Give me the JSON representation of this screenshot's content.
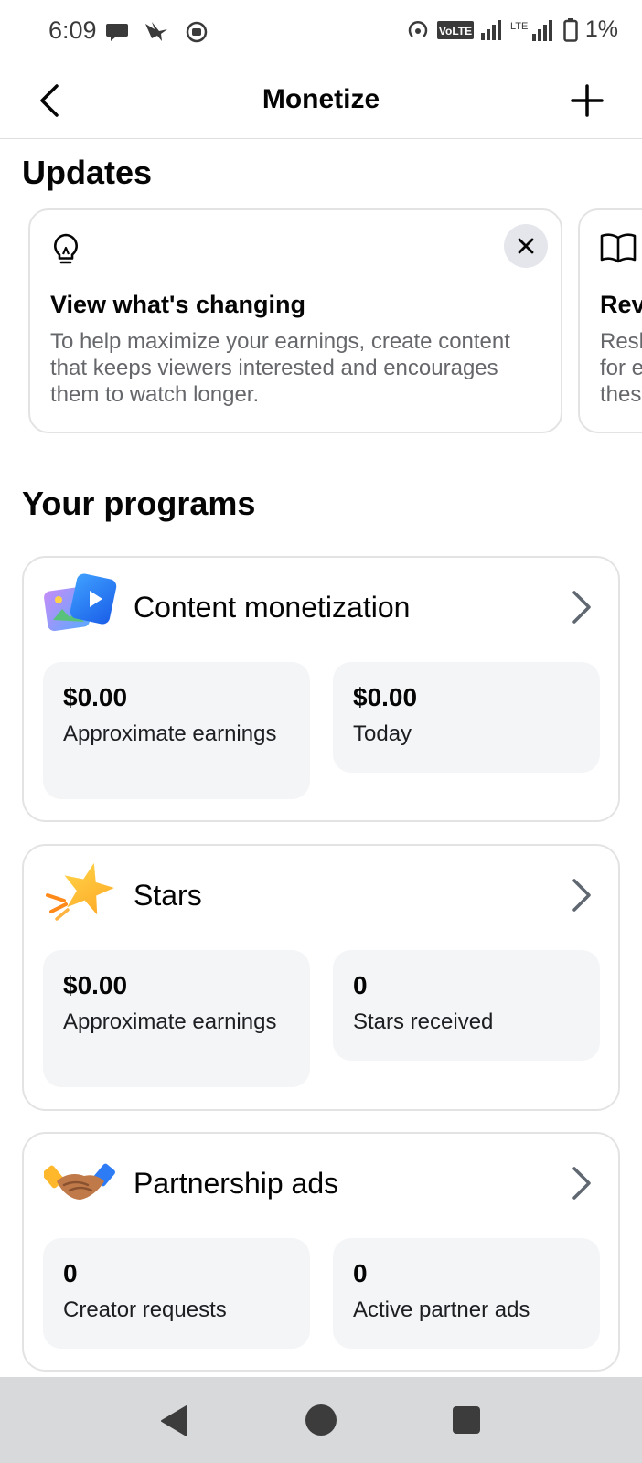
{
  "status_bar": {
    "time": "6:09",
    "battery_percent": "1%",
    "network_label": "VoLTE",
    "lte_label": "LTE"
  },
  "header": {
    "title": "Monetize",
    "back_icon": "chevron-left-icon",
    "add_icon": "plus-icon"
  },
  "updates": {
    "section_title": "Updates",
    "cards": [
      {
        "icon": "lightbulb-icon",
        "title": "View what's changing",
        "body": "To help maximize your earnings, create content that keeps viewers interested and encourages them to watch longer."
      },
      {
        "icon": "book-icon",
        "title": "Rev",
        "body": "Resh for e thes"
      }
    ]
  },
  "programs": {
    "section_title": "Your programs",
    "items": [
      {
        "name": "Content monetization",
        "icon": "content-monetization-icon",
        "stats": [
          {
            "value": "$0.00",
            "label": "Approximate earnings"
          },
          {
            "value": "$0.00",
            "label": "Today"
          }
        ]
      },
      {
        "name": "Stars",
        "icon": "star-icon",
        "stats": [
          {
            "value": "$0.00",
            "label": "Approximate earnings"
          },
          {
            "value": "0",
            "label": "Stars received"
          }
        ]
      },
      {
        "name": "Partnership ads",
        "icon": "handshake-icon",
        "stats": [
          {
            "value": "0",
            "label": "Creator requests"
          },
          {
            "value": "0",
            "label": "Active partner ads"
          }
        ]
      }
    ]
  },
  "colors": {
    "text_primary": "#050505",
    "text_secondary": "#65676b",
    "stat_background": "#f4f5f7",
    "card_border": "#e3e3e3",
    "nav_background": "#d8d9db"
  }
}
